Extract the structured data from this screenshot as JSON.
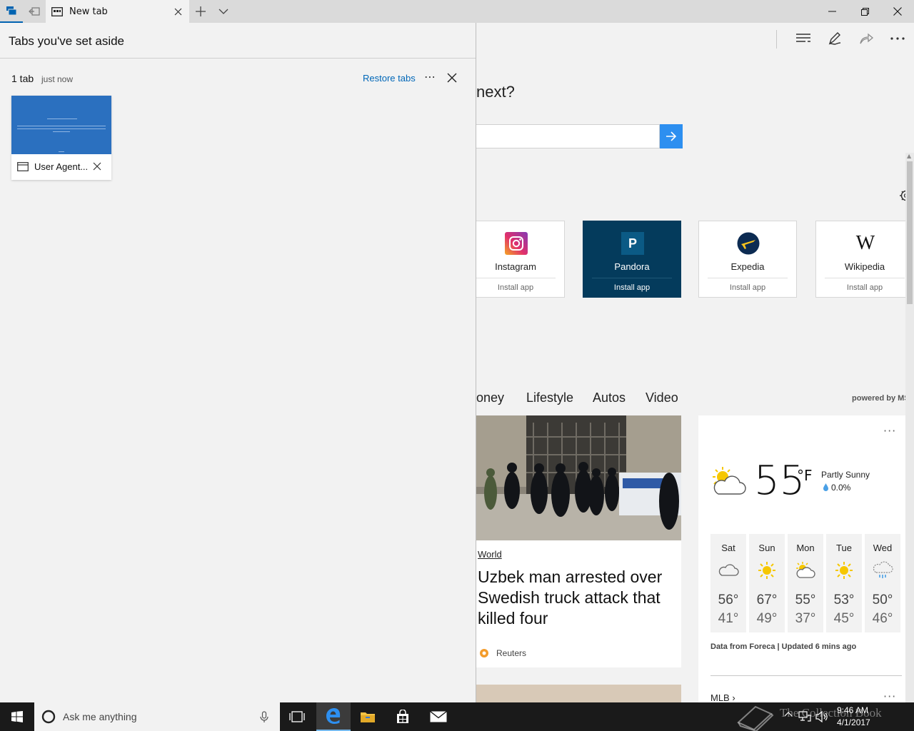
{
  "titlebar": {
    "active_tab_title": "New tab",
    "icons": [
      "tabs-aside-icon",
      "set-tabs-aside-icon",
      "new-tab-icon",
      "tab-preview-chevron-icon",
      "minimize-icon",
      "restore-icon",
      "close-icon"
    ]
  },
  "panel": {
    "title": "Tabs you've set aside",
    "group": {
      "count_label": "1 tab",
      "time_label": "just now",
      "restore_label": "Restore tabs",
      "more_label": "⋯"
    },
    "tabs": [
      {
        "label": "User Agent..."
      }
    ]
  },
  "page": {
    "question": "next?",
    "tiles": [
      {
        "name": "Instagram",
        "install": "Install app"
      },
      {
        "name": "Pandora",
        "install": "Install app",
        "logo_letter": "P"
      },
      {
        "name": "Expedia",
        "install": "Install app"
      },
      {
        "name": "Wikipedia",
        "install": "Install app",
        "logo_letter": "W"
      }
    ],
    "categories": [
      "oney",
      "Lifestyle",
      "Autos",
      "Video"
    ],
    "powered_by": "powered by MS",
    "news": {
      "category": "World",
      "headline": "Uzbek man arrested over Swedish truck attack that killed four",
      "source": "Reuters"
    },
    "weather": {
      "more": "···",
      "temp": "55",
      "unit": "°F",
      "condition": "Partly Sunny",
      "precip": "0.0%",
      "forecast": [
        {
          "day": "Sat",
          "high": "56°",
          "low": "41°",
          "icon": "cloudy"
        },
        {
          "day": "Sun",
          "high": "67°",
          "low": "49°",
          "icon": "sunny"
        },
        {
          "day": "Mon",
          "high": "55°",
          "low": "37°",
          "icon": "partly-sunny"
        },
        {
          "day": "Tue",
          "high": "53°",
          "low": "45°",
          "icon": "sunny"
        },
        {
          "day": "Wed",
          "high": "50°",
          "low": "46°",
          "icon": "rain"
        }
      ],
      "credit": "Data from Foreca | Updated 6 mins ago",
      "next_section": "MLB ›"
    }
  },
  "taskbar": {
    "search_placeholder": "Ask me anything",
    "time": "9:46 AM",
    "date": "4/1/2017",
    "watermark": "The Collection Book"
  },
  "colors": {
    "accent": "#0063b1",
    "link": "#0067b8",
    "search_button": "#2d8ff0",
    "pandora_tile": "#043b5c",
    "thumbnail": "#2b70bf",
    "taskbar": "#1a1a1a"
  }
}
